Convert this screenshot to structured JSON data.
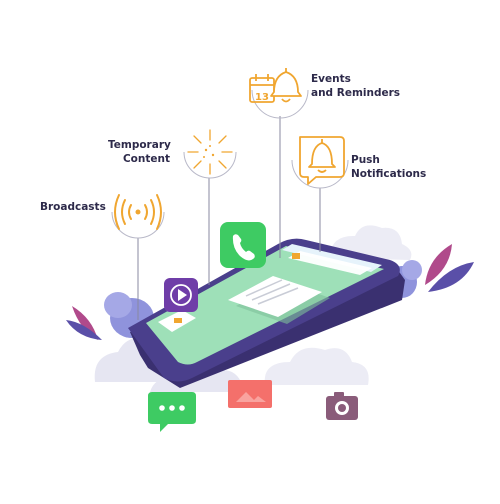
{
  "labels": {
    "broadcasts": "Broadcasts",
    "temporary_line1": "Temporary",
    "temporary_line2": "Content",
    "events_line1": "Events",
    "events_line2": "and Reminders",
    "push_line1": "Push",
    "push_line2": "Notifications"
  },
  "calendar_day": "13",
  "colors": {
    "ink": "#2d2a4a",
    "orange": "#f0a630",
    "phone_purple": "#4a3f8c",
    "screen_green": "#9ee0b8",
    "green_app": "#3ecb63",
    "purple_app": "#6f3da8",
    "coral": "#f4706b",
    "cloud": "#e6e6f2",
    "bush": "#8f93dc",
    "leaf_pink": "#b04a8b",
    "leaf_purple": "#5a4fa8"
  },
  "icons": [
    "broadcast-icon",
    "sparkle-icon",
    "calendar-bell-icon",
    "bell-icon",
    "phone-icon",
    "play-icon",
    "chat-icon",
    "camera-icon"
  ]
}
